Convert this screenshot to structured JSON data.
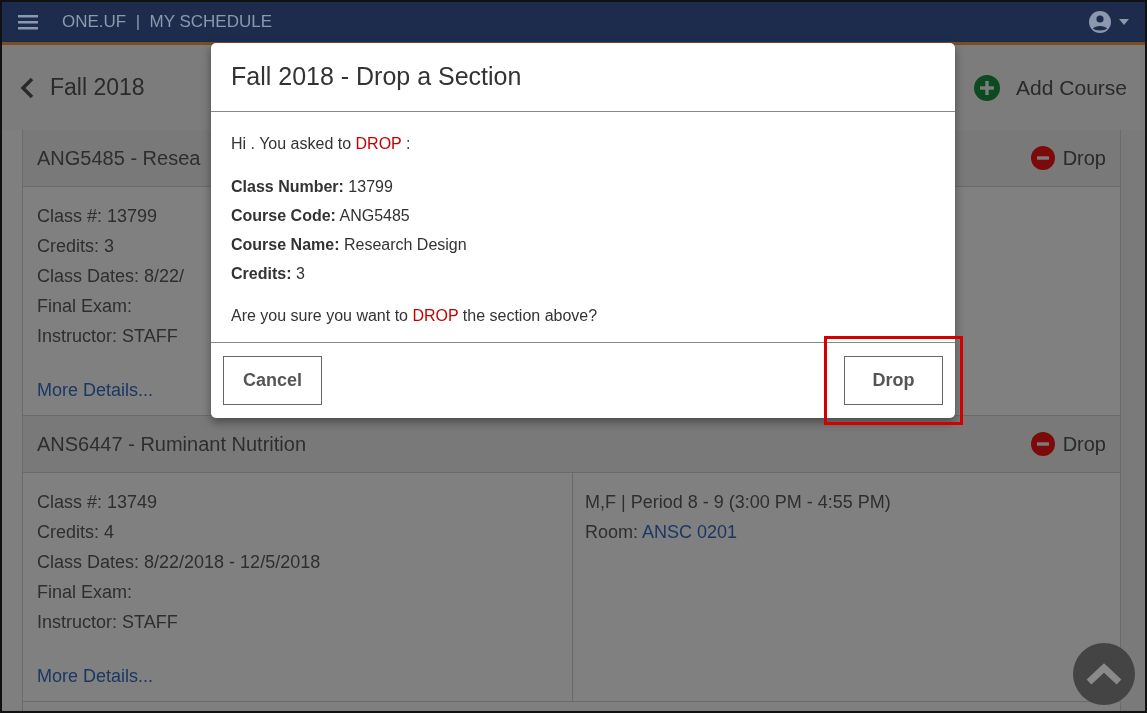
{
  "header": {
    "title": "ONE.UF  |  MY SCHEDULE"
  },
  "subheader": {
    "term": "Fall 2018",
    "add_button": "Add Course"
  },
  "courses": [
    {
      "title": "ANG5485 - Resea",
      "action": "Drop",
      "details": [
        "Class #: 13799",
        "Credits: 3",
        "Class Dates: 8/22/",
        "Final Exam:",
        "Instructor: STAFF"
      ],
      "link": "More Details..."
    },
    {
      "title": "ANS6447 - Ruminant Nutrition",
      "action": "Drop",
      "details": [
        "Class #: 13749",
        "Credits: 4",
        "Class Dates: 8/22/2018 - 12/5/2018",
        "Final Exam:",
        "Instructor: STAFF"
      ],
      "link": "More Details...",
      "schedule": "M,F | Period 8 - 9 (3:00 PM - 4:55 PM)",
      "room_label": "Room:",
      "room": "ANSC 0201"
    }
  ],
  "dialog": {
    "title": "Fall 2018 - Drop a Section",
    "intro": [
      {
        "text": "Hi . You asked to ",
        "emphasis": false
      },
      {
        "text": "DROP",
        "emphasis": true
      },
      {
        "text": " :",
        "emphasis": false
      }
    ],
    "fields": [
      {
        "label": "Class Number:",
        "value": "13799"
      },
      {
        "label": "Course Code:",
        "value": "ANG5485"
      },
      {
        "label": "Course Name:",
        "value": "Research Design"
      },
      {
        "label": "Credits:",
        "value": "3"
      }
    ],
    "question": [
      {
        "text": "Are you sure you want to ",
        "emphasis": false
      },
      {
        "text": "DROP",
        "emphasis": true
      },
      {
        "text": " the section above?",
        "emphasis": false
      }
    ],
    "buttons": [
      {
        "label": "Cancel",
        "highlighted": false
      },
      {
        "label": "Drop",
        "highlighted": true
      }
    ]
  }
}
